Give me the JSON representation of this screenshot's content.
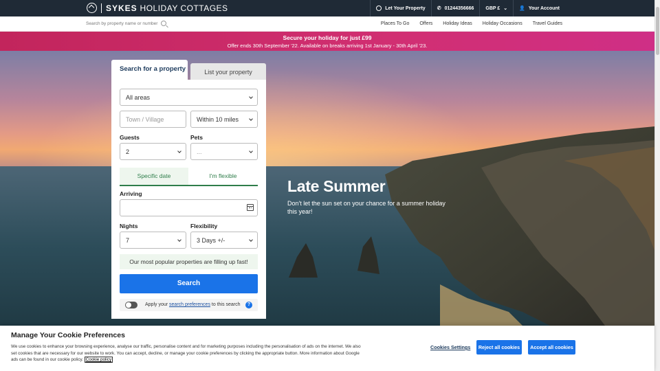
{
  "header": {
    "logo_brand": "SYKES",
    "logo_rest": "HOLIDAY COTTAGES",
    "let_property": "Let Your Property",
    "phone": "01244356666",
    "currency": "GBP £",
    "account": "Your Account"
  },
  "nav": {
    "search_placeholder": "Search by property name or number",
    "links": [
      "Places To Go",
      "Offers",
      "Holiday Ideas",
      "Holiday Occasions",
      "Travel Guides"
    ]
  },
  "promo": {
    "title": "Secure your holiday for just £99",
    "subtitle": "Offer ends 30th September '22. Available on breaks arriving 1st January - 30th April '23."
  },
  "hero": {
    "title": "Late Summer",
    "subtitle": "Don't let the sun set on your chance for a summer holiday this year!"
  },
  "search_panel": {
    "tab_active": "Search for a property",
    "tab_inactive": "List your property",
    "area": "All areas",
    "town_placeholder": "Town / Village",
    "radius": "Within 10 miles",
    "guests_label": "Guests",
    "guests_value": "2",
    "pets_label": "Pets",
    "pets_value": "...",
    "date_mode_specific": "Specific date",
    "date_mode_flexible": "I'm flexible",
    "arriving_label": "Arriving",
    "nights_label": "Nights",
    "nights_value": "7",
    "flexibility_label": "Flexibility",
    "flexibility_value": "3 Days +/-",
    "popular_notice": "Our most popular properties are filling up fast!",
    "search_button": "Search",
    "pref_prefix": "Apply your",
    "pref_link": "search preferences",
    "pref_suffix": "to this search",
    "help": "?"
  },
  "cookie": {
    "title": "Manage Your Cookie Preferences",
    "text": "We use cookies to enhance your browsing experience, analyse our traffic, personalise content and for marketing purposes including the personalisation of ads on the internet. We also set cookies that are necessary for our website to work. You can accept, decline, or manage your cookie preferences by clicking the appropriate button. More information about Google ads can be found in our cookie policy.",
    "policy_link": "Cookie policy",
    "settings": "Cookies Settings",
    "reject": "Reject all cookies",
    "accept": "Accept all cookies"
  },
  "colors": {
    "topbar": "#1f2a36",
    "promo": "#d12f72",
    "primary_button": "#1a73e8",
    "accent_green": "#2e7d4a"
  }
}
